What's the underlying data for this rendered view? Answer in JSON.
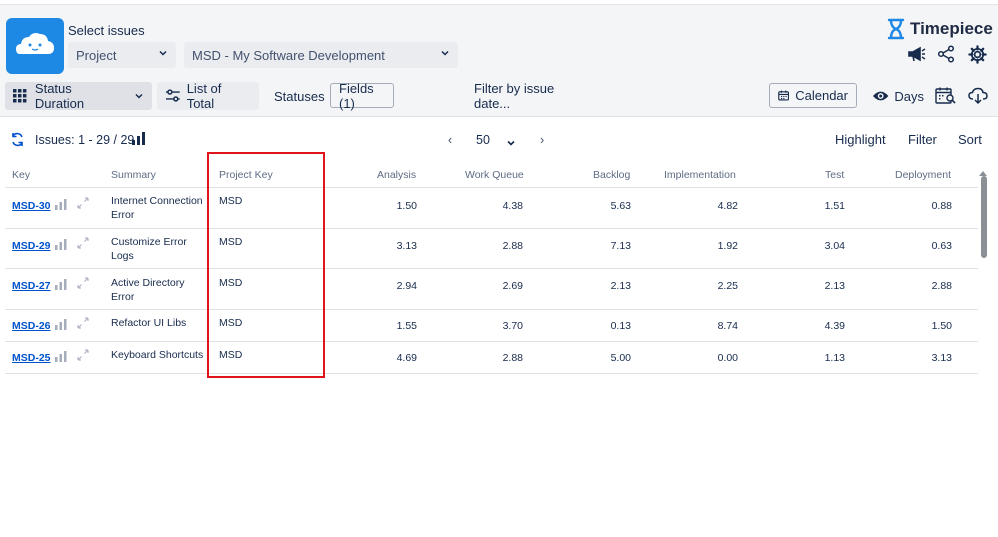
{
  "header": {
    "select_label": "Select issues",
    "project_dropdown": "Project",
    "project_value": "MSD - My Software Development",
    "brand": "Timepiece",
    "icons": [
      "announcement-icon",
      "share-icon",
      "settings-icon"
    ]
  },
  "toolbar": {
    "status_duration": "Status Duration",
    "list_of_total": "List of Total",
    "statuses": "Statuses",
    "fields": "Fields (1)",
    "filter_by_date": "Filter by issue date...",
    "calendar": "Calendar",
    "days": "Days",
    "icons": [
      "grid-icon",
      "sliders-icon",
      "calendar-icon",
      "eye-icon",
      "calendar-search-icon",
      "cloud-download-icon"
    ]
  },
  "bar2": {
    "issues": "Issues: 1 - 29 / 29",
    "page_size": "50",
    "highlight": "Highlight",
    "filter": "Filter",
    "sort": "Sort"
  },
  "table": {
    "columns": [
      "Key",
      "Summary",
      "Project Key",
      "Analysis",
      "Work Queue",
      "Backlog",
      "Implementation",
      "Test",
      "Deployment"
    ],
    "rows": [
      {
        "key": "MSD-30",
        "summary1": "Internet Connection",
        "summary2": "Error",
        "project": "MSD",
        "analysis": "1.50",
        "work_queue": "4.38",
        "backlog": "5.63",
        "implementation": "4.82",
        "test": "1.51",
        "deployment": "0.88"
      },
      {
        "key": "MSD-29",
        "summary1": "Customize Error",
        "summary2": "Logs",
        "project": "MSD",
        "analysis": "3.13",
        "work_queue": "2.88",
        "backlog": "7.13",
        "implementation": "1.92",
        "test": "3.04",
        "deployment": "0.63"
      },
      {
        "key": "MSD-27",
        "summary1": "Active Directory",
        "summary2": "Error",
        "project": "MSD",
        "analysis": "2.94",
        "work_queue": "2.69",
        "backlog": "2.13",
        "implementation": "2.25",
        "test": "2.13",
        "deployment": "2.88"
      },
      {
        "key": "MSD-26",
        "summary1": "Refactor UI Libs",
        "summary2": "",
        "project": "MSD",
        "analysis": "1.55",
        "work_queue": "3.70",
        "backlog": "0.13",
        "implementation": "8.74",
        "test": "4.39",
        "deployment": "1.50"
      },
      {
        "key": "MSD-25",
        "summary1": "Keyboard Shortcuts",
        "summary2": "",
        "project": "MSD",
        "analysis": "4.69",
        "work_queue": "2.88",
        "backlog": "5.00",
        "implementation": "0.00",
        "test": "1.13",
        "deployment": "3.13"
      }
    ]
  },
  "colors": {
    "accent": "#0052cc",
    "highlight_border": "#e0141b",
    "logo_bg": "#1e88e5"
  }
}
